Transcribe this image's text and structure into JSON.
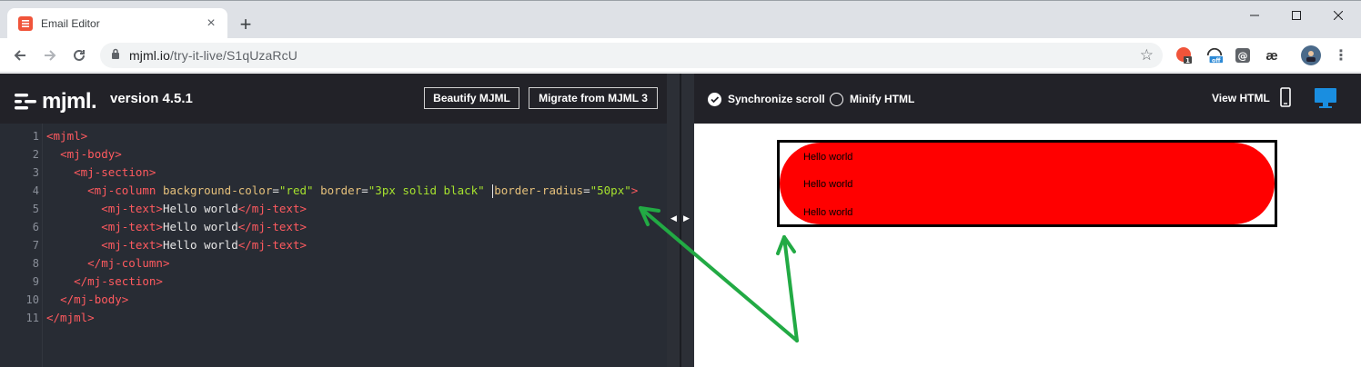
{
  "browser": {
    "tab_title": "Email Editor",
    "url_host": "mjml.io",
    "url_path": "/try-it-live/S1qUzaRcU",
    "extensions": [
      {
        "icon": "rss-icon",
        "badge": "1"
      },
      {
        "icon": "proxy-icon",
        "badge": "off"
      },
      {
        "icon": "at-icon",
        "badge": ""
      },
      {
        "icon": "ae-icon",
        "badge": "æ"
      }
    ]
  },
  "editor": {
    "logo_text": "mjml.",
    "version": "version 4.5.1",
    "beautify_label": "Beautify MJML",
    "migrate_label": "Migrate from MJML 3",
    "line_numbers": [
      "1",
      "2",
      "3",
      "4",
      "5",
      "6",
      "7",
      "8",
      "9",
      "10",
      "11"
    ],
    "code": {
      "l1": "<mjml>",
      "l2": "<mj-body>",
      "l3": "<mj-section>",
      "l4_tag": "<mj-column",
      "l4_attr1": "background-color",
      "l4_val1": "\"red\"",
      "l4_attr2": "border",
      "l4_val2": "\"3px solid black\"",
      "l4_attr3": "border-radius",
      "l4_val3": "\"50px\"",
      "l4_close": ">",
      "text_open": "<mj-text>",
      "text_content": "Hello world",
      "text_close": "</mj-text>",
      "l8": "</mj-column>",
      "l9": "</mj-section>",
      "l10": "</mj-body>",
      "l11": "</mjml>"
    }
  },
  "preview": {
    "sync_scroll_label": "Synchronize scroll",
    "sync_scroll_checked": true,
    "minify_label": "Minify HTML",
    "minify_checked": false,
    "view_html_label": "View HTML",
    "active_view": "desktop",
    "email_texts": [
      "Hello world",
      "Hello world",
      "Hello world"
    ],
    "column_background": "#ff0000",
    "column_border": "3px solid black",
    "column_radius": "50px"
  },
  "colors": {
    "annotation_arrow": "#22aa44",
    "accent_blue": "#1a8ee0"
  }
}
